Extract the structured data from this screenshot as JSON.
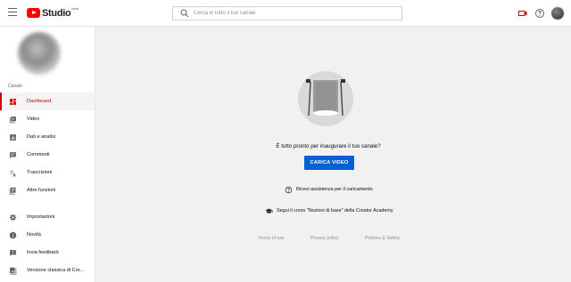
{
  "header": {
    "logo_text": "Studio",
    "logo_sup": "beta",
    "search_placeholder": "Cerca in tutto il tuo canale"
  },
  "sidebar": {
    "section_label": "Canale",
    "items": [
      {
        "label": "Dashboard",
        "icon": "dashboard-icon",
        "active": true
      },
      {
        "label": "Video",
        "icon": "video-library-icon"
      },
      {
        "label": "Dati e analisi",
        "icon": "analytics-icon"
      },
      {
        "label": "Commenti",
        "icon": "comments-icon"
      },
      {
        "label": "Trascrizioni",
        "icon": "translate-icon"
      },
      {
        "label": "Altre funzioni",
        "icon": "more-features-icon"
      }
    ],
    "bottom_items": [
      {
        "label": "Impostazioni",
        "icon": "gear-icon"
      },
      {
        "label": "Novità",
        "icon": "info-icon"
      },
      {
        "label": "Invia feedback",
        "icon": "feedback-icon"
      },
      {
        "label": "Versione classica di Creator Studio",
        "icon": "classic-studio-icon"
      }
    ]
  },
  "main": {
    "prompt": "È tutto pronto per inaugurare il tuo canale?",
    "upload_button": "CARICA VIDEO",
    "help_link": "Ricevi assistenza per il caricamento",
    "academy_link": "Segui il corso \"Nozioni di base\" della Creator Academy",
    "footer": [
      "Terms of use",
      "Privacy policy",
      "Policies & Safety"
    ]
  },
  "colors": {
    "accent_red": "#cc0000",
    "button_blue": "#065fd4",
    "background": "#f1f1f1"
  }
}
